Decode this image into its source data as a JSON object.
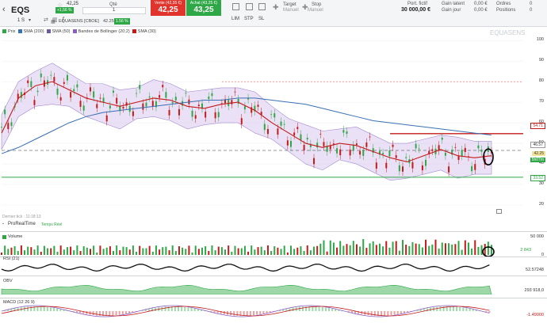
{
  "app": {
    "symbol": "EQS",
    "price": "42,25",
    "change": "+1,56 %",
    "timeframe": "1 S",
    "qty_label": "Qté",
    "qty_value": "1"
  },
  "trade": {
    "sell_label": "Vente (42,35 €)",
    "sell_price": "42,25",
    "buy_label": "Achat (43,25 €)",
    "buy_price": "43,25",
    "lim": "LIM",
    "stp": "STP",
    "sl": "SL",
    "target_title": "Target",
    "target_sub": "Manuel",
    "stop_title": "Stop",
    "stop_sub": "Manuel"
  },
  "account": {
    "port_label": "Port. fictif",
    "port_value": "30 000,00 €",
    "latent_label": "Gain latent",
    "latent_value": "0,00 €",
    "day_label": "Gain jour",
    "day_value": "0,00 €",
    "orders_label": "Ordres",
    "orders_value": "0",
    "positions_label": "Positions",
    "positions_value": "0"
  },
  "chart": {
    "title": "EQUASENS [CBOE]",
    "title_price": "42.25",
    "title_change": "1.56 %",
    "watermark": "EQUASENS",
    "legend": [
      "Prix",
      "SMA (200)",
      "SMA (50)",
      "Bandes de Bollinger (20;2)",
      "SMA (30)"
    ],
    "legend_colors": [
      "#2ea846",
      "#3a6fb3",
      "#6c5c9f",
      "#c9b3e6",
      "#c41a1a"
    ],
    "y_ticks": [
      "100",
      "90",
      "80",
      "70",
      "60",
      "50",
      "40",
      "30",
      "20"
    ],
    "level_red": "54.71",
    "level_dash": "46.57",
    "level_price": "42.25",
    "level_time": "5h07m",
    "level_green": "33.52",
    "last_tick": "Dernier tick : 11:18:13",
    "realtime": "ProRealTime",
    "realtime_sub": "Temps Réel"
  },
  "chart_data": [
    {
      "type": "line",
      "title": "EQUASENS [CBOE]",
      "ylim": [
        15,
        102
      ],
      "series": [
        {
          "name": "SMA (30)",
          "values": [
            55,
            72,
            78,
            80,
            76,
            72,
            70,
            68,
            70,
            72,
            71,
            68,
            67,
            69,
            70,
            66,
            60,
            55,
            50,
            48,
            50,
            49,
            46,
            43,
            41,
            44,
            47,
            44,
            43,
            44
          ]
        },
        {
          "name": "SMA (200)",
          "values": [
            45,
            48,
            52,
            56,
            60,
            63,
            65,
            66,
            67,
            68,
            69,
            70,
            71,
            71,
            72,
            72,
            71,
            70,
            69,
            67,
            65,
            63,
            61,
            60,
            59,
            58,
            57,
            56,
            55,
            54
          ]
        }
      ]
    },
    {
      "type": "bar",
      "title": "Volume",
      "y_ticks": [
        "50 000",
        "0"
      ],
      "volume_value": "2 843"
    },
    {
      "type": "line",
      "title": "RSI (21)",
      "last_value": "52.57248"
    },
    {
      "type": "area",
      "title": "OBV",
      "last_value": "293 918,0"
    },
    {
      "type": "line",
      "title": "MACD (12 26 9)",
      "last_value": "-1.49000"
    }
  ]
}
